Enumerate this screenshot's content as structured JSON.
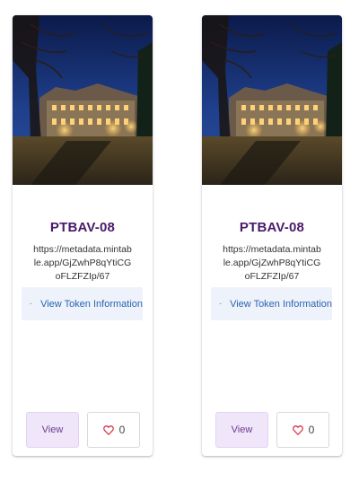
{
  "cards": [
    {
      "title": "PTBAV-08",
      "url": "https://metadata.mintable.app/GjZwhP8qYtiCGoFLZFZIp/67",
      "token_button": "View Token Information",
      "view_button": "View",
      "like_count": "0",
      "image": "illuminated-university-building-night",
      "icons": {
        "token": "chevron-down-icon",
        "like": "heart-outline-icon"
      }
    },
    {
      "title": "PTBAV-08",
      "url": "https://metadata.mintable.app/GjZwhP8qYtiCGoFLZFZIp/67",
      "token_button": "View Token Information",
      "view_button": "View",
      "like_count": "0",
      "image": "illuminated-university-building-night",
      "icons": {
        "token": "chevron-down-icon",
        "like": "heart-outline-icon"
      }
    }
  ],
  "colors": {
    "title": "#4a1a6b",
    "token_link": "#2b63b0",
    "token_bg": "#eef3fb",
    "view_bg": "#f0e6fa",
    "heart": "#d8263c"
  }
}
